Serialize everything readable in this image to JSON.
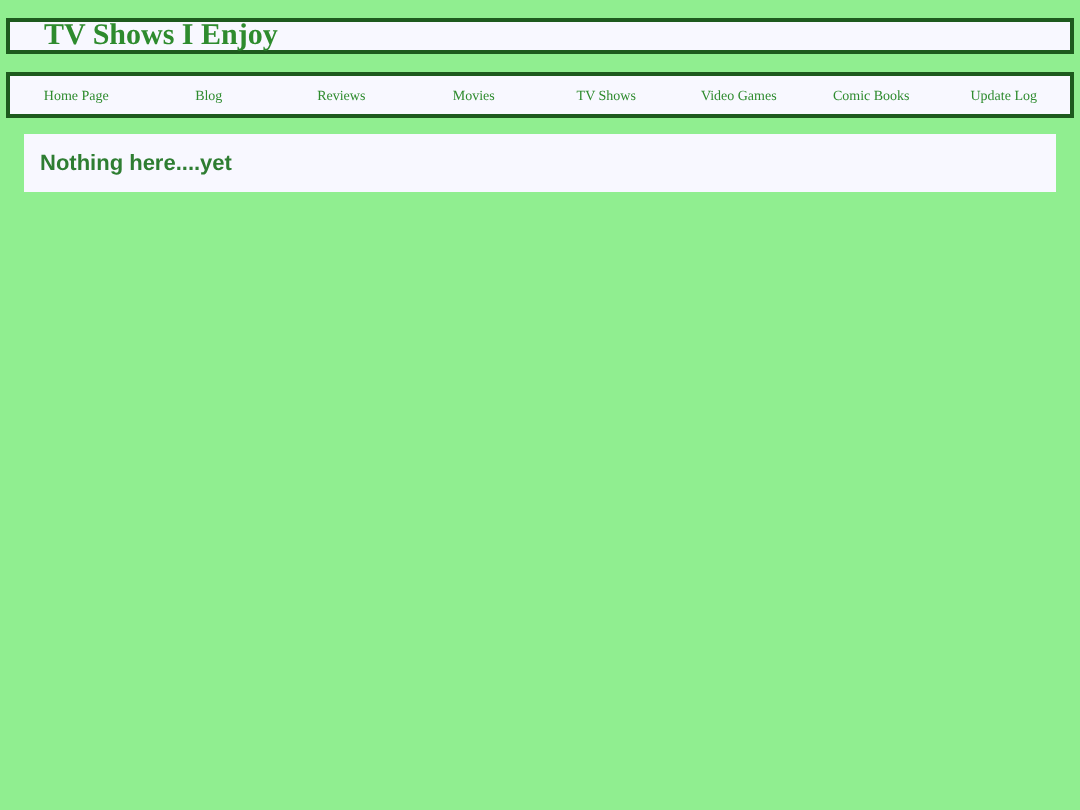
{
  "header": {
    "title": "TV Shows I Enjoy"
  },
  "nav": {
    "items": [
      {
        "label": "Home Page"
      },
      {
        "label": "Blog"
      },
      {
        "label": "Reviews"
      },
      {
        "label": "Movies"
      },
      {
        "label": "TV Shows"
      },
      {
        "label": "Video Games"
      },
      {
        "label": "Comic Books"
      },
      {
        "label": "Update Log"
      }
    ]
  },
  "content": {
    "message": "Nothing here....yet"
  }
}
